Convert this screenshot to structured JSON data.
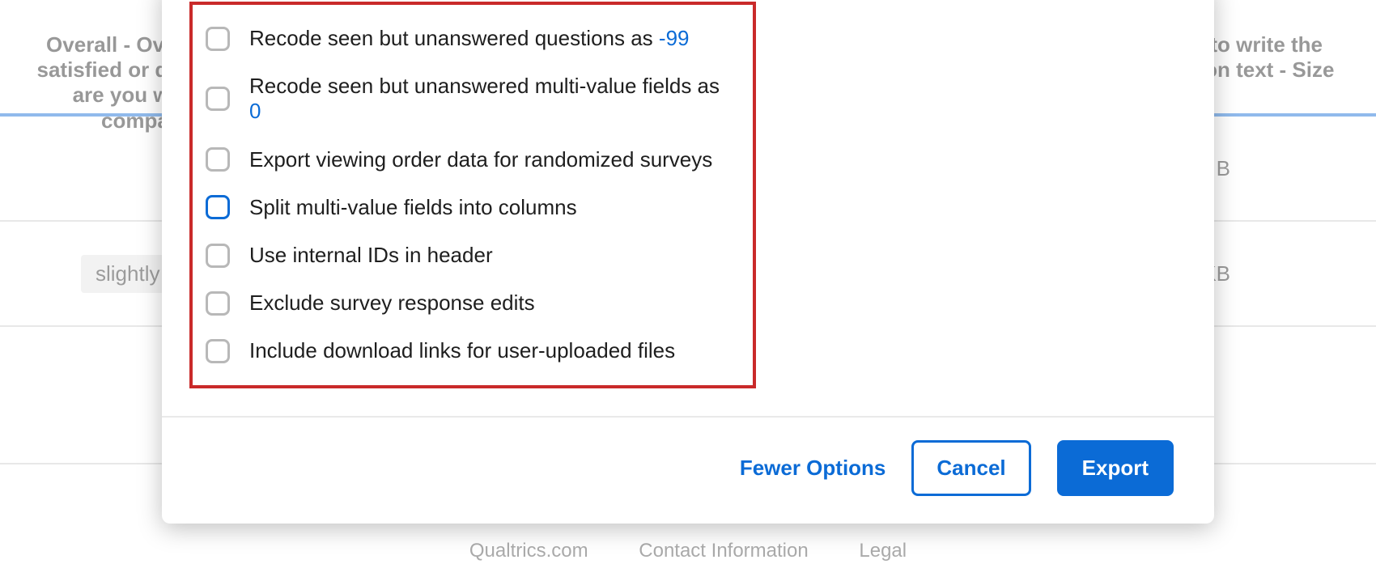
{
  "background": {
    "col_left": "Overall - Overall, how satisfied or dissatisfied are you with our company?",
    "col_right": "Click to write the question text - Size",
    "row1_right": "B",
    "row2_left": "slightly",
    "row2_right": "KB",
    "footer": {
      "a": "Qualtrics.com",
      "b": "Contact Information",
      "c": "Legal"
    }
  },
  "options": [
    {
      "label_pre": "Recode seen but unanswered questions as ",
      "value": "-99",
      "checked": false,
      "focused": false
    },
    {
      "label_pre": "Recode seen but unanswered multi-value fields as ",
      "value": "0",
      "checked": false,
      "focused": false
    },
    {
      "label_pre": "Export viewing order data for randomized surveys",
      "value": "",
      "checked": false,
      "focused": false
    },
    {
      "label_pre": "Split multi-value fields into columns",
      "value": "",
      "checked": false,
      "focused": true
    },
    {
      "label_pre": "Use internal IDs in header",
      "value": "",
      "checked": false,
      "focused": false
    },
    {
      "label_pre": "Exclude survey response edits",
      "value": "",
      "checked": false,
      "focused": false
    },
    {
      "label_pre": "Include download links for user-uploaded files",
      "value": "",
      "checked": false,
      "focused": false
    }
  ],
  "buttons": {
    "fewer": "Fewer Options",
    "cancel": "Cancel",
    "export": "Export"
  },
  "colors": {
    "accent": "#0b6bd6",
    "highlight": "#c92a2a"
  }
}
